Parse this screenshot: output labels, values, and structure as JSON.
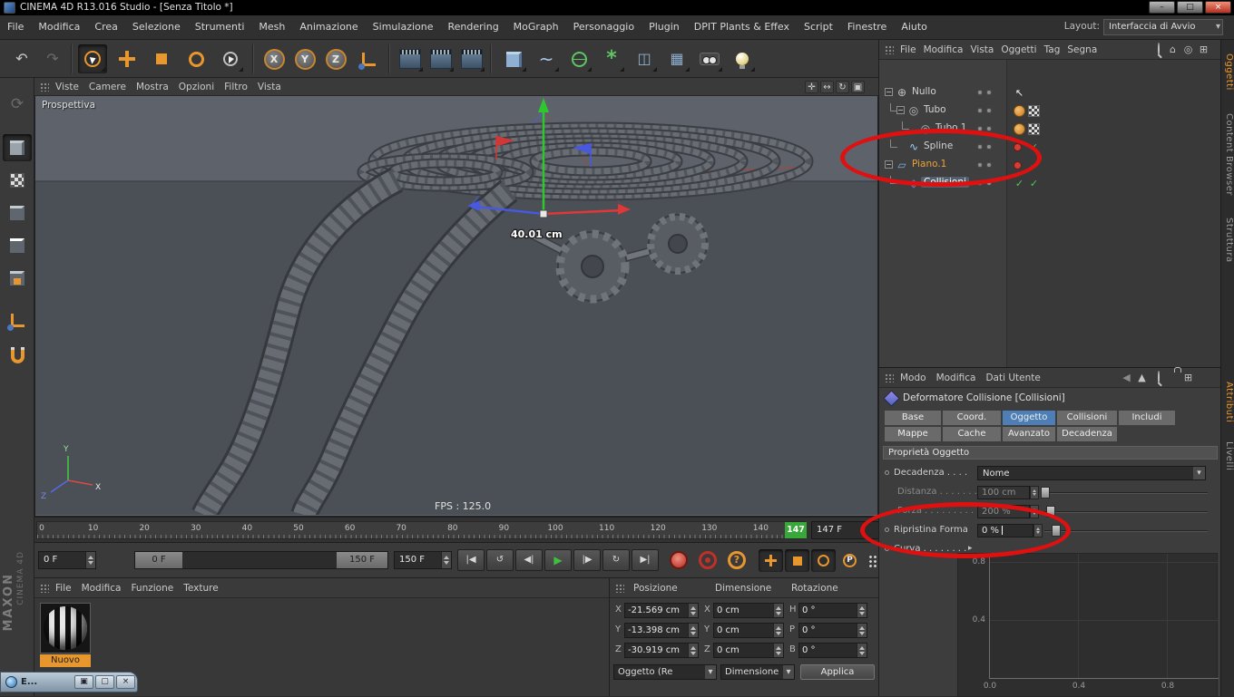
{
  "colors": {
    "accent_orange": "#e8962e",
    "selection_blue": "#4d7fb6",
    "annotation_red": "#e01010",
    "play_green": "#3fbf3f",
    "marker_green": "#39a83a"
  },
  "window": {
    "title": "CINEMA 4D R13.016 Studio - [Senza Titolo *]",
    "minimize": "–",
    "maximize": "□",
    "close": "×"
  },
  "menubar": {
    "items": [
      "File",
      "Modifica",
      "Crea",
      "Selezione",
      "Strumenti",
      "Mesh",
      "Animazione",
      "Simulazione",
      "Rendering",
      "MoGraph",
      "Personaggio",
      "Plugin",
      "DPIT Plants & Effex",
      "Script",
      "Finestre",
      "Aiuto"
    ],
    "layout_label": "Layout:",
    "layout_value": "Interfaccia di Avvio"
  },
  "icons": {
    "undo": "↶",
    "redo": "↷",
    "axis_x": "X",
    "axis_y": "Y",
    "axis_z": "Z",
    "chevron_down": "▾",
    "goto_start": "|◀",
    "play_backward": "↺",
    "prev_frame": "◀|",
    "play": "▶",
    "next_frame": "|▶",
    "loop": "↻",
    "goto_end": "▶|",
    "record_help": "?",
    "minus": "−",
    "check": "✓",
    "cursor": "↖",
    "expand_right": "▸",
    "home": "⌂",
    "back": "◀",
    "up": "▲",
    "add_panel": "⊞",
    "target": "◎",
    "pan_view": "✛",
    "zoom_view": "↔",
    "rotate_view": "↻",
    "toggle_view": "▣"
  },
  "viewport": {
    "menu": [
      "Viste",
      "Camere",
      "Mostra",
      "Opzioni",
      "Filtro",
      "Vista"
    ],
    "camera_label": "Prospettiva",
    "fps": "FPS : 125.0",
    "measurement": "40.01 cm",
    "axis_x": "X",
    "axis_y": "Y",
    "axis_z": "Z"
  },
  "timeline": {
    "ticks": [
      "0",
      "10",
      "20",
      "30",
      "40",
      "50",
      "60",
      "70",
      "80",
      "90",
      "100",
      "110",
      "120",
      "130",
      "140"
    ],
    "current_frame": "147",
    "frame_field": "147 F"
  },
  "transport": {
    "start_field": "0 F",
    "range_start": "0 F",
    "range_end": "150 F",
    "end_field": "150 F"
  },
  "materials": {
    "menu": [
      "File",
      "Modifica",
      "Funzione",
      "Texture"
    ],
    "selected_name": "Nuovo"
  },
  "coordinates": {
    "columns": [
      "Posizione",
      "Dimensione",
      "Rotazione"
    ],
    "cells": [
      {
        "label": "X",
        "value": "-21.569 cm"
      },
      {
        "label": "X",
        "value": "0 cm"
      },
      {
        "label": "H",
        "value": "0 °"
      },
      {
        "label": "Y",
        "value": "-13.398 cm"
      },
      {
        "label": "Y",
        "value": "0 cm"
      },
      {
        "label": "P",
        "value": "0 °"
      },
      {
        "label": "Z",
        "value": "-30.919 cm"
      },
      {
        "label": "Z",
        "value": "0 cm"
      },
      {
        "label": "B",
        "value": "0 °"
      }
    ],
    "mode_dropdown": "Oggetto (Re",
    "size_dropdown": "Dimensione",
    "apply_button": "Applica"
  },
  "object_manager": {
    "menu": [
      "File",
      "Modifica",
      "Vista",
      "Oggetti",
      "Tag",
      "Segna"
    ],
    "tree": [
      {
        "name": "Nullo",
        "depth": 0,
        "expander": true,
        "icon": "null-object-icon",
        "tags": [
          "cursor"
        ]
      },
      {
        "name": "Tubo",
        "depth": 1,
        "expander": true,
        "icon": "tube-icon",
        "tags": [
          "phong",
          "texture"
        ]
      },
      {
        "name": "Tubo.1",
        "depth": 2,
        "expander": false,
        "icon": "tube-icon",
        "tags": [
          "phong",
          "texture"
        ]
      },
      {
        "name": "Spline",
        "depth": 1,
        "expander": false,
        "icon": "spline-icon",
        "tags": [
          "reddot",
          "check"
        ]
      },
      {
        "name": "Piano.1",
        "depth": 0,
        "expander": true,
        "icon": "plane-icon",
        "color": "#e8a33d",
        "tags": [
          "reddot",
          "check"
        ]
      },
      {
        "name": "Collisioni",
        "depth": 1,
        "expander": false,
        "icon": "collision-icon",
        "color": "#ffffff",
        "selected": true,
        "tags": [
          "check",
          "check"
        ]
      }
    ]
  },
  "attributes": {
    "menu": [
      "Modo",
      "Modifica",
      "Dati Utente"
    ],
    "title": "Deformatore Collisione [Collisioni]",
    "tabs_row1": [
      "Base",
      "Coord.",
      "Oggetto",
      "Collisioni",
      "Includi"
    ],
    "tabs_row2": [
      "Mappe",
      "Cache",
      "Avanzato",
      "Decadenza"
    ],
    "active_tab": "Oggetto",
    "section": "Proprietà Oggetto",
    "fields": [
      {
        "label": "Decadenza . . . .",
        "type": "dropdown",
        "value": "Nome",
        "enabled": true,
        "dot": true
      },
      {
        "label": "Distanza . . . . . . .",
        "type": "slider",
        "value": "100 cm",
        "enabled": false,
        "knob": 178
      },
      {
        "label": "Forza . . . . . . . . .",
        "type": "slider",
        "value": "200 %",
        "enabled": false,
        "knob": 184
      },
      {
        "label": "Ripristina Forma",
        "type": "input",
        "value": "0 %",
        "enabled": true,
        "dot": true
      },
      {
        "label": "Curva . . . . . . . .",
        "type": "expand",
        "value": "",
        "enabled": true,
        "dot": true
      }
    ],
    "curve_y_labels": [
      "0.8",
      "0.4"
    ],
    "curve_x_labels": [
      "0.0",
      "0.4",
      "0.8"
    ]
  },
  "side_tabs": {
    "top": [
      "Oggetti",
      "Content Browser",
      "Struttura"
    ],
    "bottom": [
      "Attributi",
      "Livelli"
    ],
    "active_top": "Oggetti",
    "active_bottom": "Attributi"
  },
  "branding": {
    "maxon": "MAXON",
    "cinema": "CINEMA 4D"
  },
  "mini_window": {
    "label": "E..."
  }
}
